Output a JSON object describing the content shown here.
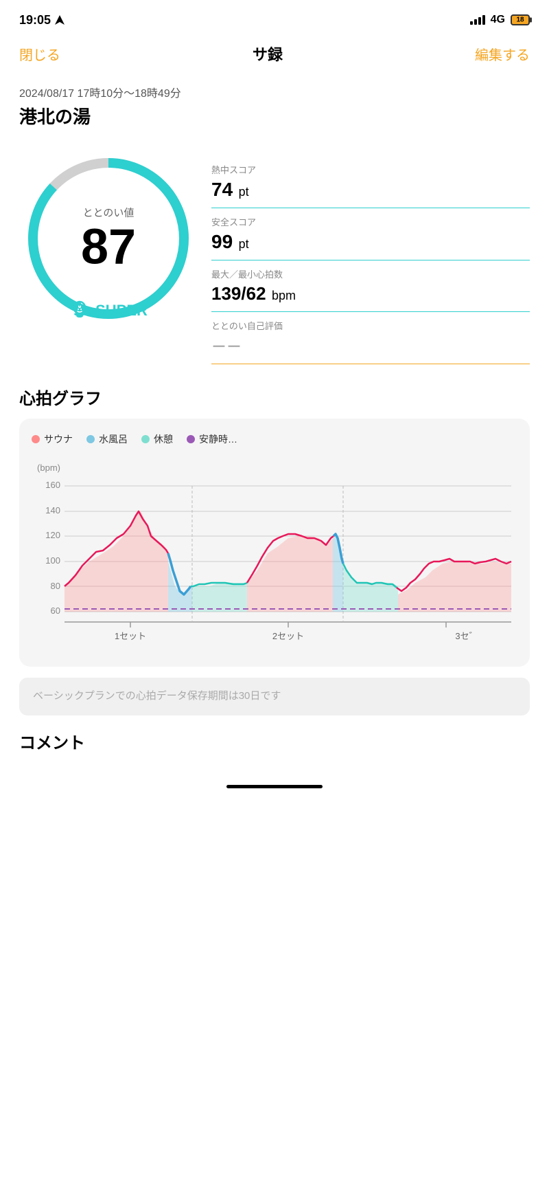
{
  "statusBar": {
    "time": "19:05",
    "network": "4G",
    "battery": "18"
  },
  "navBar": {
    "close": "閉じる",
    "title": "サ録",
    "edit": "編集する"
  },
  "session": {
    "datetime": "2024/08/17 17時10分〜18時49分",
    "place": "港北の湯"
  },
  "scoreCircle": {
    "label": "ととのい値",
    "value": "87",
    "badge": "SUPER"
  },
  "stats": [
    {
      "label": "熱中スコア",
      "value": "74",
      "unit": "pt"
    },
    {
      "label": "安全スコア",
      "value": "99",
      "unit": "pt"
    },
    {
      "label": "最大／最小心拍数",
      "value": "139/62",
      "unit": "bpm"
    },
    {
      "label": "ととのい自己評価",
      "value": "－－",
      "unit": ""
    }
  ],
  "heartRateGraph": {
    "title": "心拍グラフ",
    "legend": [
      {
        "label": "サウナ",
        "color": "#ff8a8a"
      },
      {
        "label": "水風呂",
        "color": "#7ec8e3"
      },
      {
        "label": "休憩",
        "color": "#7edfd0"
      },
      {
        "label": "安静時…",
        "color": "#9b59b6"
      }
    ],
    "yLabels": [
      "160",
      "140",
      "120",
      "100",
      "80",
      "60"
    ],
    "yAxisLabel": "(bpm)",
    "xLabels": [
      "1セット",
      "2セット",
      "3セ゛"
    ],
    "infoText": "ベーシックプランでの心拍データ保存期間は30日です"
  },
  "comment": {
    "title": "コメント"
  }
}
